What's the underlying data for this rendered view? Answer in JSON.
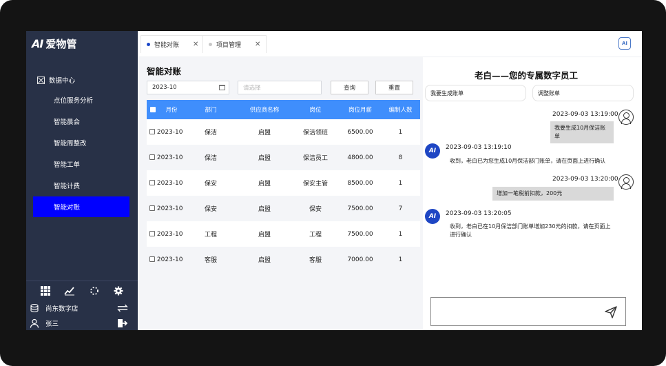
{
  "app": {
    "logo_mark": "AI",
    "logo_text": "爱物管"
  },
  "sidebar": {
    "group": "数据中心",
    "items": [
      {
        "label": "点位服务分析"
      },
      {
        "label": "智能晨会"
      },
      {
        "label": "智能周整改"
      },
      {
        "label": "智能工单"
      },
      {
        "label": "智能计费"
      },
      {
        "label": "智能对账",
        "active": true
      }
    ],
    "bottom": {
      "org": "尚东数字店",
      "user": "张三"
    }
  },
  "tabs": [
    {
      "label": "智能对账",
      "active": true
    },
    {
      "label": "项目管理",
      "active": false
    }
  ],
  "left": {
    "title": "智能对账",
    "date_value": "2023-10",
    "select_placeholder": "请选择",
    "query_label": "查询",
    "reset_label": "重置",
    "columns": [
      "月份",
      "部门",
      "供应商名称",
      "岗位",
      "岗位月薪",
      "编制人数"
    ],
    "rows": [
      {
        "month": "2023-10",
        "dept": "保洁",
        "supplier": "启盟",
        "post": "保洁领班",
        "salary": "6500.00",
        "count": "1"
      },
      {
        "month": "2023-10",
        "dept": "保洁",
        "supplier": "启盟",
        "post": "保洁员工",
        "salary": "4800.00",
        "count": "8"
      },
      {
        "month": "2023-10",
        "dept": "保安",
        "supplier": "启盟",
        "post": "保安主管",
        "salary": "8500.00",
        "count": "1"
      },
      {
        "month": "2023-10",
        "dept": "保安",
        "supplier": "启盟",
        "post": "保安",
        "salary": "7500.00",
        "count": "7"
      },
      {
        "month": "2023-10",
        "dept": "工程",
        "supplier": "启盟",
        "post": "工程",
        "salary": "7500.00",
        "count": "1"
      },
      {
        "month": "2023-10",
        "dept": "客服",
        "supplier": "启盟",
        "post": "客服",
        "salary": "7000.00",
        "count": "1"
      }
    ]
  },
  "chat": {
    "title": "老白——您的专属数字员工",
    "quick_1": "我要生成账单",
    "quick_2": "调整账单",
    "messages": [
      {
        "from": "user",
        "time": "2023-09-03 13:19:00",
        "text": "我要生成10月保洁账单"
      },
      {
        "from": "bot",
        "time": "2023-09-03 13:19:10",
        "text": "收到，老白已为您生成10月保洁部门账单，请在页面上进行确认"
      },
      {
        "from": "user",
        "time": "2023-09-03 13:20:00",
        "text": "增加一笔税前扣款，200元"
      },
      {
        "from": "bot",
        "time": "2023-09-03 13:20:05",
        "text": "收到，老白已在10月保洁部门账单增加230元的扣款，请在页面上进行确认"
      }
    ],
    "bot_avatar": "AI"
  }
}
